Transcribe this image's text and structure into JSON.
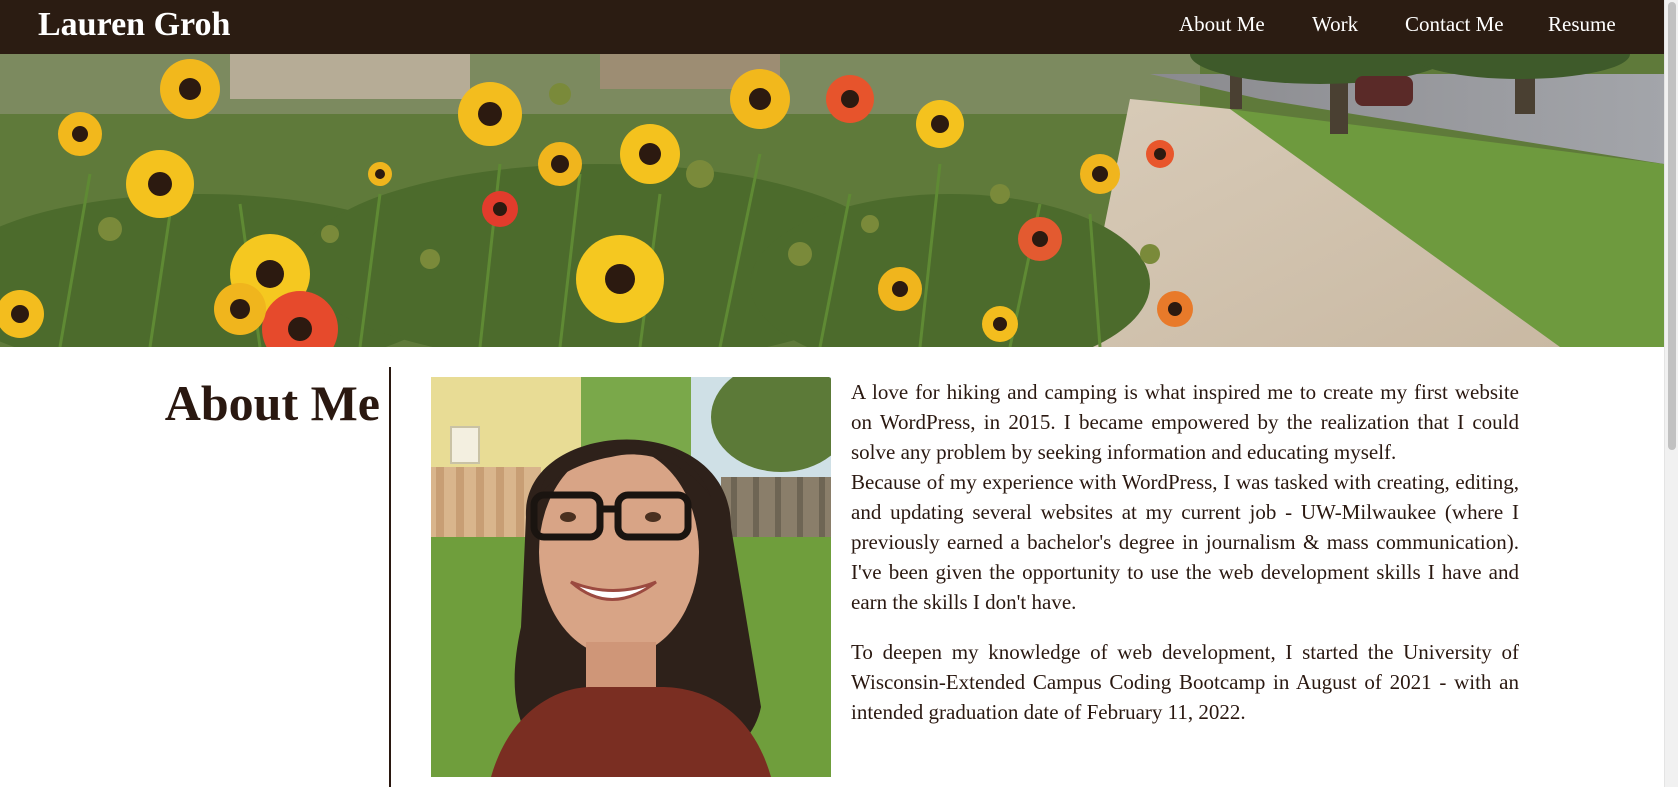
{
  "header": {
    "site_title": "Lauren Groh",
    "nav": [
      {
        "label": "About Me"
      },
      {
        "label": "Work"
      },
      {
        "label": "Contact Me"
      },
      {
        "label": "Resume"
      }
    ]
  },
  "about": {
    "heading": "About Me",
    "paragraphs": [
      "A love for hiking and camping is what inspired me to create my first website on WordPress, in 2015. I became empowered by the realization that I could solve any problem by seeking information and educating myself.",
      "Because of my experience with WordPress, I was tasked with creating, editing, and updating several websites at my current job - UW-Milwaukee (where I previously earned a bachelor's degree in journalism & mass communication). I've been given the opportunity to use the web development skills I have and earn the skills I don't have.",
      "To deepen my knowledge of web development, I started the University of Wisconsin-Extended Campus Coding Bootcamp in August of 2021 - with an intended graduation date of February 11, 2022."
    ]
  },
  "colors": {
    "header_bg": "#2b1c12",
    "text": "#2a1810"
  }
}
